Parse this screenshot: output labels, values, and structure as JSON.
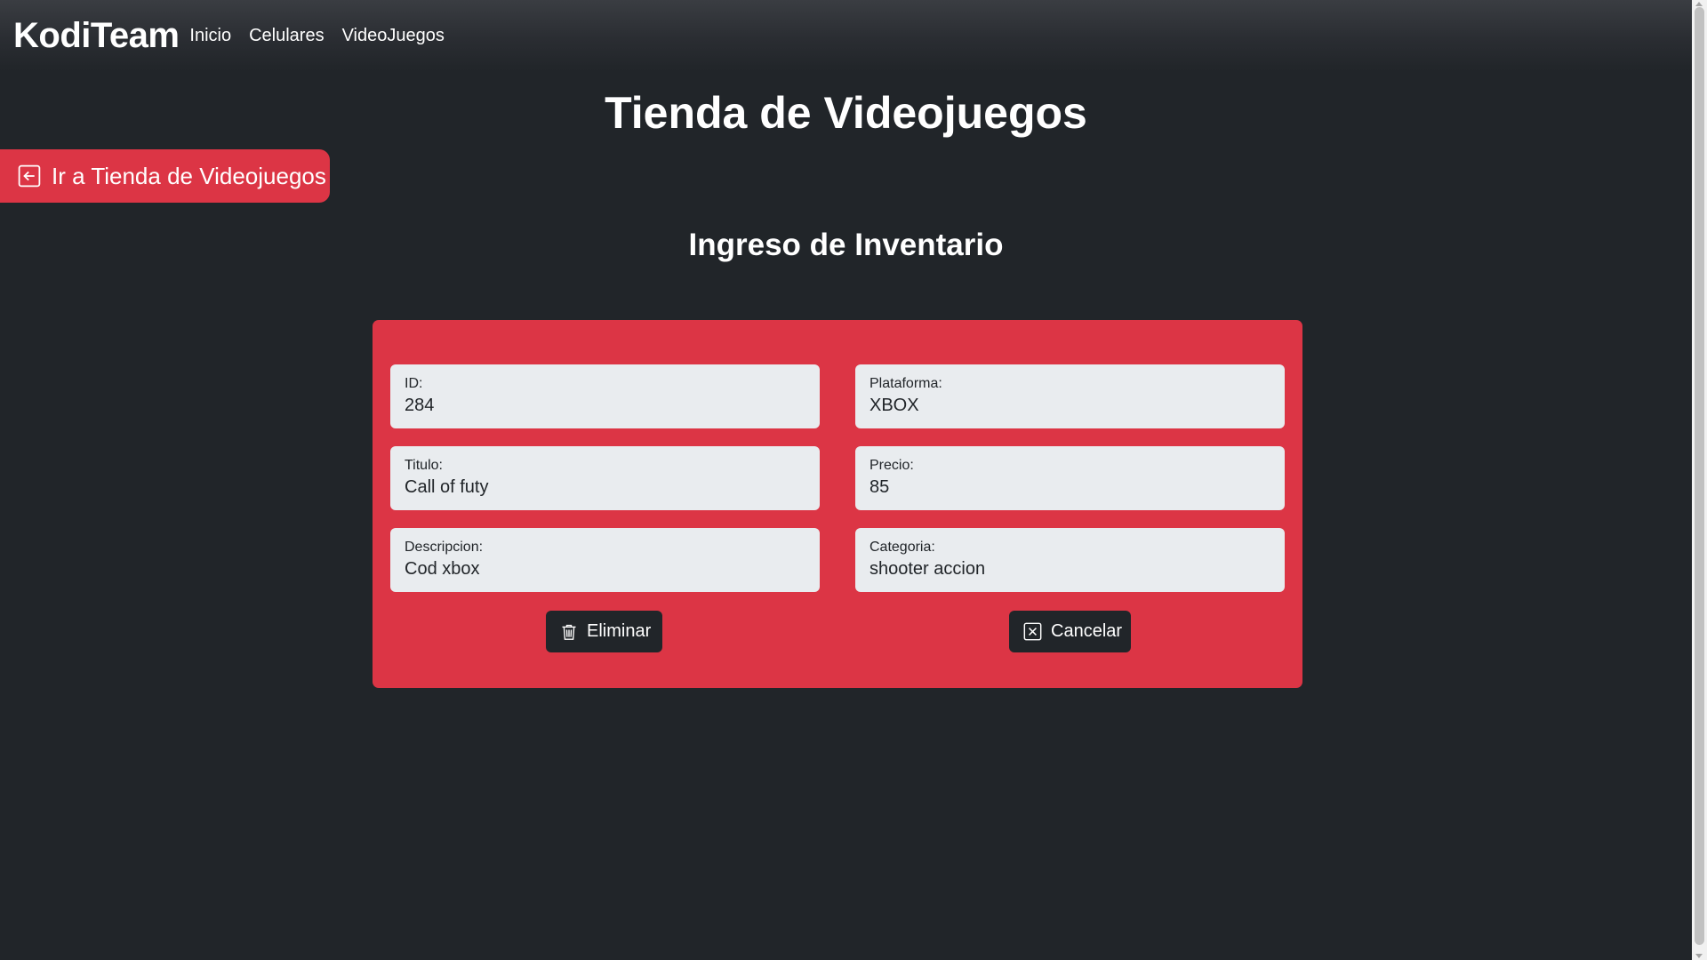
{
  "navbar": {
    "brand": "KodiTeam",
    "links": [
      "Inicio",
      "Celulares",
      "VideoJuegos"
    ]
  },
  "page_title": "Tienda de Videojuegos",
  "back_button": {
    "label": "Ir a Tienda de Videojuegos",
    "icon": "arrow-left-square-icon"
  },
  "section_title": "Ingreso de Inventario",
  "form": {
    "id": {
      "label": "ID:",
      "value": "284"
    },
    "plataforma": {
      "label": "Plataforma:",
      "value": "XBOX"
    },
    "titulo": {
      "label": "Titulo:",
      "value": "Call of futy"
    },
    "precio": {
      "label": "Precio:",
      "value": "85"
    },
    "descripcion": {
      "label": "Descripcion:",
      "value": "Cod xbox"
    },
    "categoria": {
      "label": "Categoria:",
      "value": "shooter accion"
    }
  },
  "buttons": {
    "delete": {
      "label": "Eliminar",
      "icon": "trash-icon"
    },
    "cancel": {
      "label": "Cancelar",
      "icon": "x-square-icon"
    }
  },
  "colors": {
    "background": "#212529",
    "accent": "#dc3545",
    "field_bg": "#e9ecef",
    "button_dark": "#212529"
  }
}
